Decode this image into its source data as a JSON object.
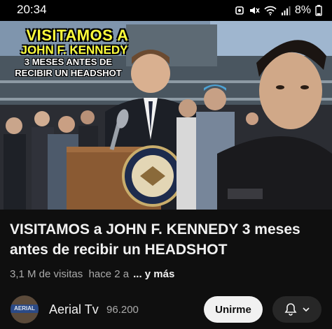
{
  "status_bar": {
    "time": "20:34",
    "battery": "8%"
  },
  "thumbnail": {
    "overlay_lines": [
      "VISITAMOS A",
      "JOHN F. KENNEDY",
      "3 MESES ANTES DE",
      "RECIBIR UN HEADSHOT"
    ],
    "seal_text": "PRESIDENT"
  },
  "video": {
    "title": "VISITAMOS a JOHN F. KENNEDY 3 meses antes de recibir un HEADSHOT",
    "views": "3,1 M de visitas",
    "age": "hace 2 a",
    "more": "... y más"
  },
  "channel": {
    "name": "Aerial Tv",
    "subscribers": "96.200",
    "avatar_text": "AERIAL"
  },
  "actions": {
    "subscribe": "Unirme"
  },
  "colors": {
    "background": "#0f0f0f",
    "overlay_yellow": "#ffff3b",
    "subscribe_bg": "#f1f1f1",
    "bell_bg": "#272727"
  },
  "icons": [
    "alarm-icon",
    "mute-icon",
    "wifi-icon",
    "signal-icon",
    "battery-icon",
    "bell-icon",
    "chevron-down-icon"
  ]
}
